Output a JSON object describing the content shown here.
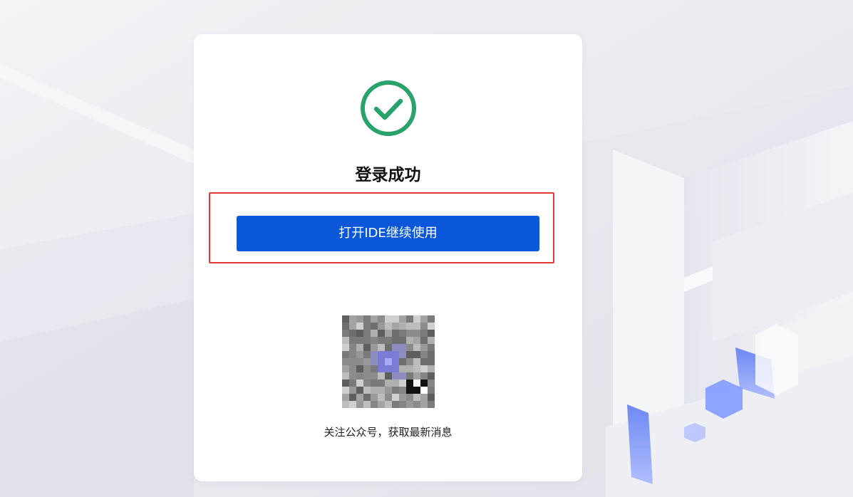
{
  "card": {
    "title": "登录成功",
    "open_ide_button_label": "打开IDE继续使用",
    "qr_caption": "关注公众号，获取最新消息"
  },
  "colors": {
    "success_green": "#2aa36b",
    "primary_blue": "#0b57d9",
    "highlight_red": "#e33a33"
  },
  "icons": {
    "status": "check-circle-icon"
  }
}
